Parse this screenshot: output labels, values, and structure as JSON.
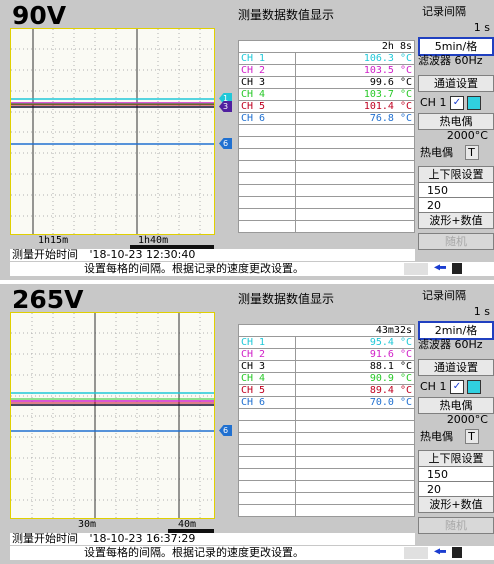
{
  "panels": [
    {
      "label": "90V",
      "table_title": "测量数据数值显示",
      "elapsed": "2h 8s",
      "ticks": [
        "1h15m",
        "1h40m"
      ],
      "channels": [
        {
          "name": "CH 1",
          "value": "106.3 °C",
          "color": "#20c8d8"
        },
        {
          "name": "CH 2",
          "value": "103.5 °C",
          "color": "#d020c8"
        },
        {
          "name": "CH 3",
          "value": "99.6 °C",
          "color": "#000000"
        },
        {
          "name": "CH 4",
          "value": "103.7 °C",
          "color": "#28c828"
        },
        {
          "name": "CH 5",
          "value": "101.4 °C",
          "color": "#c00020"
        },
        {
          "name": "CH 6",
          "value": "76.8 °C",
          "color": "#2070d0"
        }
      ],
      "markers": [
        "1",
        "3",
        "6"
      ],
      "status_label": "测量开始时间",
      "status_time": "'18-10-23 12:30:40",
      "message": "设置每格的间隔。根据记录的速度更改设置。",
      "side": {
        "interval_title": "记录间隔",
        "interval_value": "1 s",
        "div_button": "5min/格",
        "filter": "滤波器 60Hz",
        "channel_settings": "通道设置",
        "ch_select": "CH 1",
        "thermo_type": "热电偶",
        "thermo_range": "2000°C",
        "thermo_label": "热电偶",
        "thermo_code": "T",
        "limits_title": "上下限设置",
        "upper": "150",
        "lower": "20",
        "mode": "波形+数值",
        "disabled_btn": "随机"
      }
    },
    {
      "label": "265V",
      "table_title": "测量数据数值显示",
      "elapsed": "43m32s",
      "ticks": [
        "30m",
        "40m"
      ],
      "channels": [
        {
          "name": "CH 1",
          "value": "95.4 °C",
          "color": "#20c8d8"
        },
        {
          "name": "CH 2",
          "value": "91.6 °C",
          "color": "#d020c8"
        },
        {
          "name": "CH 3",
          "value": "88.1 °C",
          "color": "#000000"
        },
        {
          "name": "CH 4",
          "value": "90.9 °C",
          "color": "#28c828"
        },
        {
          "name": "CH 5",
          "value": "89.4 °C",
          "color": "#c00020"
        },
        {
          "name": "CH 6",
          "value": "70.0 °C",
          "color": "#2070d0"
        }
      ],
      "markers": [
        "6"
      ],
      "status_label": "测量开始时间",
      "status_time": "'18-10-23 16:37:29",
      "message": "设置每格的间隔。根据记录的速度更改设置。",
      "side": {
        "interval_title": "记录间隔",
        "interval_value": "1 s",
        "div_button": "2min/格",
        "filter": "滤波器 60Hz",
        "channel_settings": "通道设置",
        "ch_select": "CH 1",
        "thermo_type": "热电偶",
        "thermo_range": "2000°C",
        "thermo_label": "热电偶",
        "thermo_code": "T",
        "limits_title": "上下限设置",
        "upper": "150",
        "lower": "20",
        "mode": "波形+数值",
        "disabled_btn": "随机"
      }
    }
  ]
}
